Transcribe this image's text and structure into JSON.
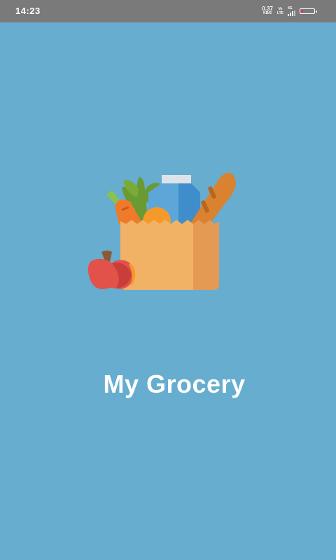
{
  "status_bar": {
    "time": "14:23",
    "net_speed_value": "0.37",
    "net_speed_unit": "KB/S",
    "volte_top": "Vo",
    "volte_bottom": "LTE",
    "network_type": "4G",
    "battery_color": "#e5374a"
  },
  "splash": {
    "background_color": "#66adcf",
    "logo_icon": "grocery-bag-icon",
    "title": "My Grocery"
  }
}
